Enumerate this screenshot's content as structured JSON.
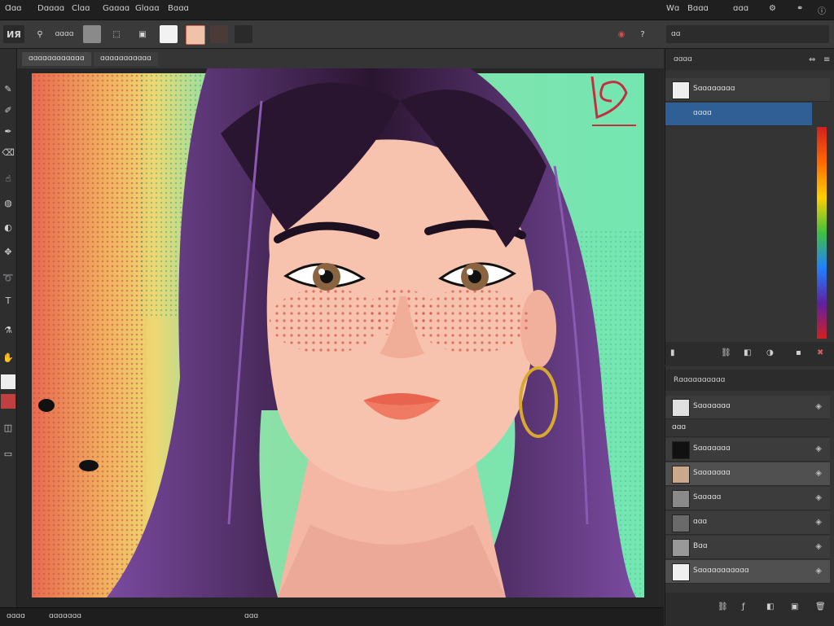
{
  "menubar": {
    "items": [
      "Ɑɑɑ",
      "Dɑɑɑɑ",
      "Clɑɑ",
      "Gɑɑɑɑ",
      "Glɑɑɑ",
      "Bɑɑɑ"
    ],
    "right_items": [
      "Wɑ",
      "Bɑɑɑ",
      "ɑɑɑ"
    ]
  },
  "optbar": {
    "logo": "ИЯ",
    "tool_label": "ɑɑɑɑ",
    "right_label": "ɑɑ"
  },
  "tabs": [
    "ɑɑɑɑɑɑɑɑɑɑɑɑ",
    "ɑɑɑɑɑɑɑɑɑɑɑ"
  ],
  "status": {
    "left": "ɑɑɑɑ",
    "mid": "ɑɑɑɑɑɑɑ",
    "right": "ɑɑɑ"
  },
  "panels": {
    "color": {
      "title": "ɑɑɑɑ",
      "row1": "Sɑɑɑɑɑɑɑɑ",
      "row2_selected": "ɑɑɑɑ"
    },
    "layers": {
      "title": "Rɑɑɑɑɑɑɑɑɑɑ",
      "items": [
        {
          "name": "Sɑɑɑɑɑɑɑ",
          "thumb_color": "#e0e0e0"
        },
        {
          "name": "ɑɑɑ",
          "thumb_color": "#555555"
        },
        {
          "name": "Sɑɑɑɑɑɑɑ",
          "thumb_color": "#111111"
        },
        {
          "name": "Sɑɑɑɑɑɑɑ",
          "thumb_color": "#c9a98a"
        },
        {
          "name": "Sɑɑɑɑɑ",
          "thumb_color": "#8a8a8a"
        },
        {
          "name": "ɑɑɑ",
          "thumb_color": "#6a6a6a"
        },
        {
          "name": "Bɑɑ",
          "thumb_color": "#999999"
        },
        {
          "name": "Sɑɑɑɑɑɑɑɑɑɑɑ",
          "thumb_color": "#f0f0f0"
        }
      ]
    }
  },
  "colors": {
    "accent": "#2f5f95",
    "background": "#2b2b2b",
    "canvas_left": "#e66b52",
    "canvas_right": "#74e6b2",
    "hair": "#2a1530",
    "skin": "#f7c2ae"
  }
}
